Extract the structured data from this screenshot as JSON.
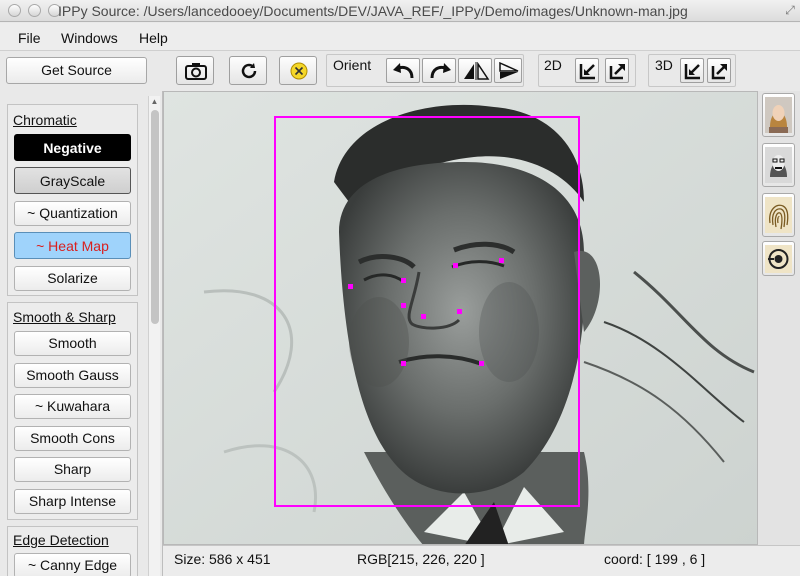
{
  "window": {
    "title": "IPPy Source:  /Users/lancedooey/Documents/DEV/JAVA_REF/_IPPy/Demo/images/Unknown-man.jpg"
  },
  "menu": {
    "items": [
      "File",
      "Windows",
      "Help"
    ]
  },
  "get_source_label": "Get Source",
  "toolbar": {
    "orient_label": "Orient",
    "label_2d": "2D",
    "label_3d": "3D"
  },
  "sidebar": {
    "chromatic": {
      "title": "Chromatic",
      "buttons": [
        "Negative",
        "GrayScale",
        "~ Quantization",
        "~ Heat Map",
        "Solarize"
      ]
    },
    "smooth_sharp": {
      "title": "Smooth & Sharp",
      "buttons": [
        "Smooth",
        "Smooth Gauss",
        "~ Kuwahara",
        "Smooth Cons",
        "Sharp",
        "Sharp Intense"
      ]
    },
    "edge": {
      "title": "Edge Detection",
      "buttons": [
        "~ Canny Edge"
      ]
    }
  },
  "status": {
    "size": "Size: 586 x 451",
    "rgb": "RGB[215, 226, 220 ]",
    "coord": "coord: [ 199 , 6 ]"
  },
  "colors": {
    "negative_bg": "#000000",
    "heatmap_bg": "#9fd3fb",
    "heatmap_text": "#d9201f",
    "overlay": "#ff00ff",
    "close_btn": "#f5d728"
  },
  "icons": {
    "toolbar": [
      "camera-icon",
      "refresh-icon",
      "close-circle-icon",
      "rotate-left-icon",
      "rotate-right-icon",
      "flip-horizontal-icon",
      "flip-vertical-icon",
      "export-in-icon",
      "export-out-icon"
    ],
    "right_strip": [
      "face-color-icon",
      "face-detect-icon",
      "fingerprint-icon",
      "iris-icon"
    ]
  }
}
